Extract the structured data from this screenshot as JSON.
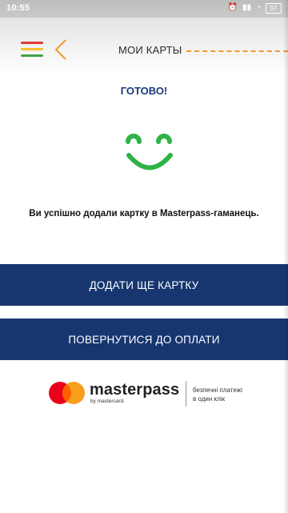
{
  "status_bar": {
    "time": "10:55",
    "alarm_icon": "alarm-icon",
    "signal_icon": "signal-icon",
    "wifi_icon": "wifi-icon",
    "battery": "97"
  },
  "header": {
    "title": "МОИ КАРТЫ",
    "menu_icon": "hamburger-menu-icon",
    "back_icon": "chevron-left-icon",
    "menu_colors": [
      "#e53935",
      "#fbc02d",
      "#43a047"
    ],
    "accent": "#f29b2c"
  },
  "content": {
    "done_title": "ГОТОВО!",
    "smiley_icon": "smile-icon",
    "smiley_color": "#2fb345",
    "message": "Ви успішно додали картку в Masterpass-гаманець."
  },
  "buttons": {
    "add_card": "ДОДАТИ ЩЕ КАРТКУ",
    "return_payment": "ПОВЕРНУТИСЯ ДО ОПЛАТИ",
    "color": "#173670"
  },
  "masterpass": {
    "logo_icon": "mastercard-circles-icon",
    "wordmark": "masterpass",
    "sub": "by mastercard.",
    "tagline_line1": "безпечні платежі",
    "tagline_line2": "в один клік"
  }
}
